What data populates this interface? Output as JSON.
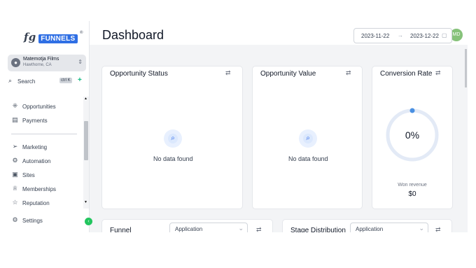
{
  "brand": {
    "logo_fg": "fg",
    "logo_text": "FUNNELS",
    "logo_mark": "®"
  },
  "account": {
    "name": "Matemotja Films",
    "location": "Hawthorne, CA"
  },
  "search": {
    "label": "Search",
    "shortcut": "ctrl K"
  },
  "sidebar": {
    "items": [
      {
        "label": "Opportunities",
        "icon": "opportunities-icon",
        "glyph": "⁜"
      },
      {
        "label": "Payments",
        "icon": "payments-icon",
        "glyph": "▤"
      },
      {
        "label": "Marketing",
        "icon": "send-icon",
        "glyph": "➢"
      },
      {
        "label": "Automation",
        "icon": "automation-icon",
        "glyph": "⚙"
      },
      {
        "label": "Sites",
        "icon": "sites-icon",
        "glyph": "▣"
      },
      {
        "label": "Memberships",
        "icon": "memberships-icon",
        "glyph": "♕"
      },
      {
        "label": "Reputation",
        "icon": "star-icon",
        "glyph": "☆"
      },
      {
        "label": "Settings",
        "icon": "gear-icon",
        "glyph": "⚙"
      }
    ]
  },
  "topbar": {
    "avatar_initials": "MD"
  },
  "page": {
    "title": "Dashboard"
  },
  "daterange": {
    "start": "2023-11-22",
    "end": "2023-12-22"
  },
  "cards": {
    "opportunity_status": {
      "title": "Opportunity Status",
      "empty": "No data found"
    },
    "opportunity_value": {
      "title": "Opportunity Value",
      "empty": "No data found"
    },
    "conversion_rate": {
      "title": "Conversion Rate",
      "value": "0%",
      "won_label": "Won revenue",
      "won_value": "$0",
      "rate": 0
    },
    "funnel": {
      "title": "Funnel",
      "select": "Application"
    },
    "stage_distribution": {
      "title": "Stage Distribution",
      "select": "Application"
    }
  },
  "colors": {
    "accent": "#2f6fe4",
    "green": "#16a34a",
    "orange": "#f97316",
    "purple": "#6d5dd3",
    "avatar": "#86c27a"
  }
}
